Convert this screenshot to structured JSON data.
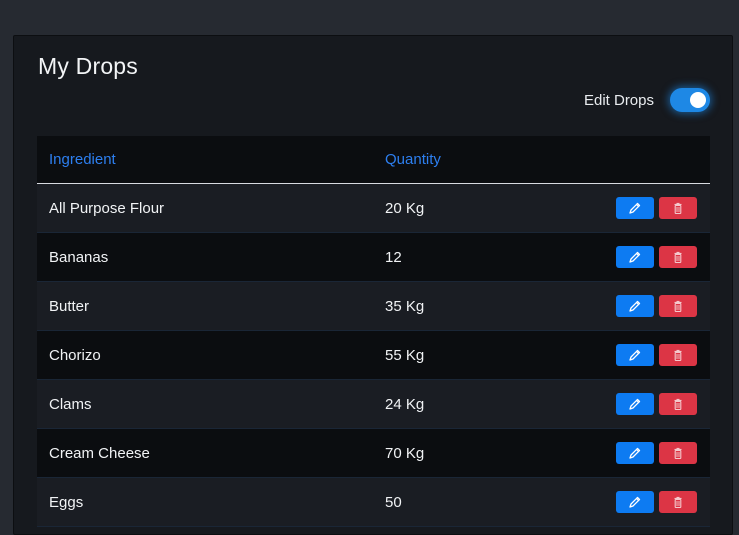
{
  "page": {
    "title": "My Drops",
    "edit_toggle": {
      "label": "Edit Drops",
      "on": true
    }
  },
  "table": {
    "headers": {
      "ingredient": "Ingredient",
      "quantity": "Quantity"
    },
    "rows": [
      {
        "ingredient": "All Purpose Flour",
        "quantity": "20 Kg"
      },
      {
        "ingredient": "Bananas",
        "quantity": "12"
      },
      {
        "ingredient": "Butter",
        "quantity": "35 Kg"
      },
      {
        "ingredient": "Chorizo",
        "quantity": "55 Kg"
      },
      {
        "ingredient": "Clams",
        "quantity": "24 Kg"
      },
      {
        "ingredient": "Cream Cheese",
        "quantity": "70 Kg"
      },
      {
        "ingredient": "Eggs",
        "quantity": "50"
      }
    ],
    "row_actions": [
      {
        "name": "edit",
        "icon": "pencil-icon",
        "color": "#0d7bf2"
      },
      {
        "name": "delete",
        "icon": "trash-icon",
        "color": "#dc3545"
      }
    ]
  },
  "colors": {
    "accent": "#1e88e5",
    "header_text": "#2d7ff0",
    "danger": "#dc3545"
  }
}
